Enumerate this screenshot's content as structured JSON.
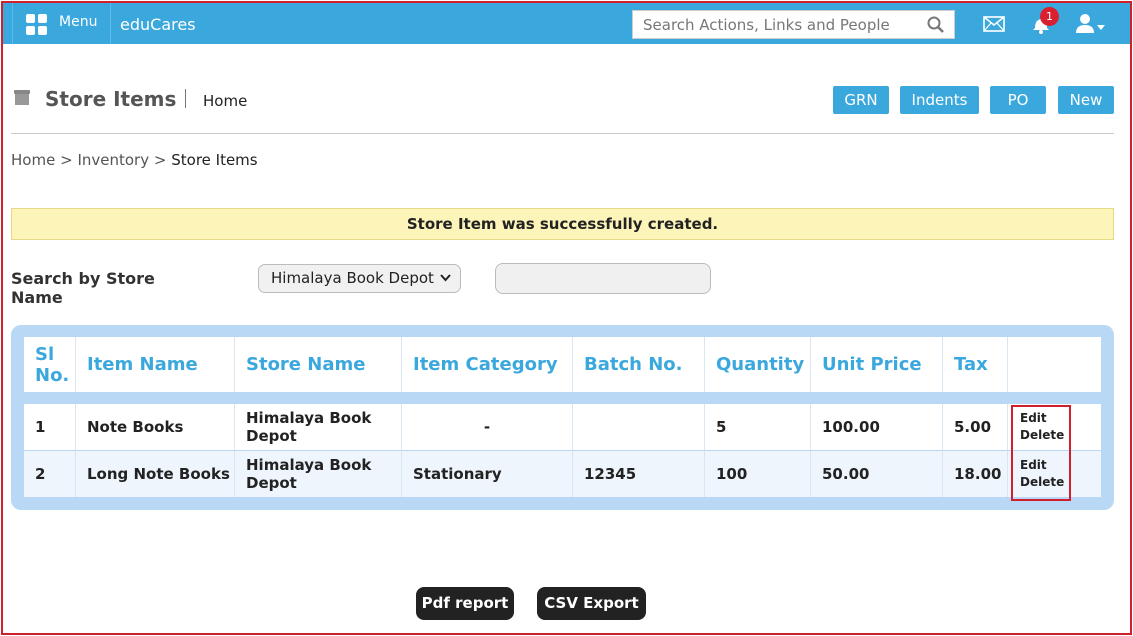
{
  "header": {
    "menu_label": "Menu",
    "brand": "eduCares",
    "search_placeholder": "Search Actions, Links and People",
    "notification_count": "1",
    "icons": [
      "grid-icon",
      "search-icon",
      "mail-icon",
      "bell-icon",
      "user-icon",
      "caret-down-icon"
    ],
    "color": "#3ba8dd"
  },
  "page": {
    "title": "Store Items",
    "subtitle": "Home",
    "buttons": [
      "GRN",
      "Indents",
      "PO",
      "New"
    ]
  },
  "breadcrumb": {
    "home": "Home",
    "sep": ">",
    "inventory": "Inventory",
    "current": "Store Items"
  },
  "alert": {
    "message": "Store Item was successfully created.",
    "color": "#fcf4b8"
  },
  "filter": {
    "label": "Search by Store Name",
    "selected_store": "Himalaya Book Depot",
    "search_value": ""
  },
  "table": {
    "columns": [
      "Sl No.",
      "Item Name",
      "Store Name",
      "Item Category",
      "Batch No.",
      "Quantity",
      "Unit Price",
      "Tax",
      ""
    ],
    "rows": [
      {
        "sl": "1",
        "item_name": "Note Books",
        "store_name": "Himalaya Book Depot",
        "category": "-",
        "batch": "",
        "quantity": "5",
        "unit_price": "100.00",
        "tax": "5.00",
        "edit": "Edit",
        "delete": "Delete"
      },
      {
        "sl": "2",
        "item_name": "Long Note Books",
        "store_name": "Himalaya Book Depot",
        "category": "Stationary",
        "batch": "12345",
        "quantity": "100",
        "unit_price": "50.00",
        "tax": "18.00",
        "edit": "Edit",
        "delete": "Delete"
      }
    ]
  },
  "footer": {
    "pdf_label": "Pdf report",
    "csv_label": "CSV Export"
  }
}
